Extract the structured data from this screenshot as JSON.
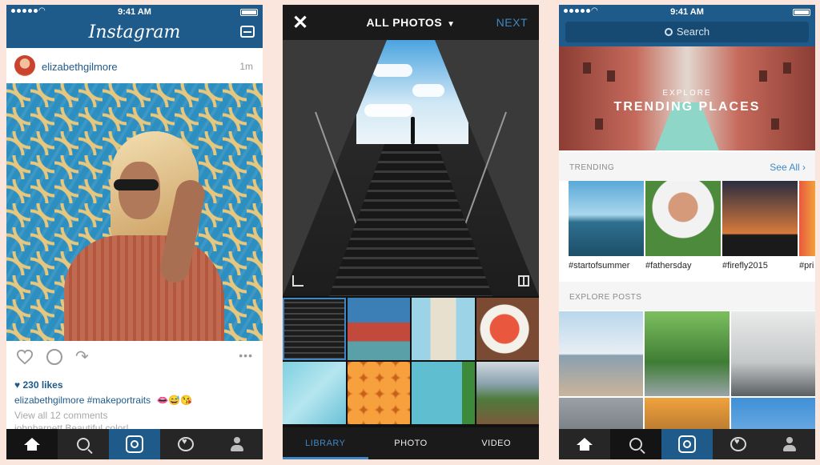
{
  "status_bar": {
    "time": "9:41 AM"
  },
  "feed": {
    "app_title": "Instagram",
    "post": {
      "username": "elizabethgilmore",
      "time_ago": "1m",
      "likes": "230 likes",
      "caption_user": "elizabethgilmore",
      "caption_text": "#makeportraits",
      "caption_emoji": "👄😅😘",
      "view_all_comments": "View all 12 comments",
      "first_comment": "johnbarnett Beautiful color!"
    },
    "tabs": [
      "home",
      "search",
      "camera",
      "activity",
      "profile"
    ]
  },
  "library": {
    "close_label": "✕",
    "title": "ALL PHOTOS",
    "next_label": "NEXT",
    "bottom_tabs": [
      "LIBRARY",
      "PHOTO",
      "VIDEO"
    ],
    "active_tab": "LIBRARY"
  },
  "explore": {
    "search_placeholder": "Search",
    "banner_eyebrow": "EXPLORE",
    "banner_title": "TRENDING PLACES",
    "trending_label": "TRENDING",
    "see_all": "See All",
    "trending_tags": [
      "#startofsummer",
      "#fathersday",
      "#firefly2015",
      "#pri"
    ],
    "explore_posts_label": "EXPLORE POSTS"
  },
  "colors": {
    "brand_blue": "#1e5a8a",
    "link_blue": "#3f88c5",
    "tabbar": "#262626",
    "background": "#fbe6dd"
  },
  "icons": {
    "feed": [
      "inbox-icon",
      "heart-icon",
      "comment-icon",
      "share-icon",
      "more-icon"
    ],
    "library": [
      "close-icon",
      "chevron-down-icon",
      "crop-icon",
      "layout-icon"
    ],
    "explore": [
      "search-icon",
      "chevron-right-icon"
    ],
    "tabbar": [
      "home-icon",
      "search-icon",
      "camera-icon",
      "activity-icon",
      "profile-icon"
    ]
  }
}
